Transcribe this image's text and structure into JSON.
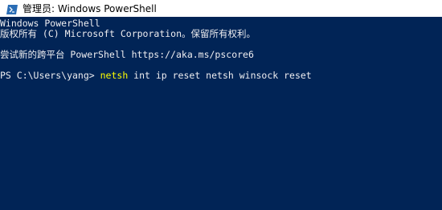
{
  "window": {
    "title": "管理员: Windows PowerShell",
    "icon": "powershell-icon"
  },
  "console": {
    "lines": [
      "Windows PowerShell",
      "版权所有 (C) Microsoft Corporation。保留所有权利。",
      "",
      "尝试新的跨平台 PowerShell https://aka.ms/pscore6",
      ""
    ],
    "prompt": "PS C:\\Users\\yang> ",
    "command": "netsh",
    "arguments": " int ip reset netsh winsock reset"
  },
  "colors": {
    "background": "#012456",
    "foreground": "#eeedf0",
    "command": "#ffff00"
  }
}
